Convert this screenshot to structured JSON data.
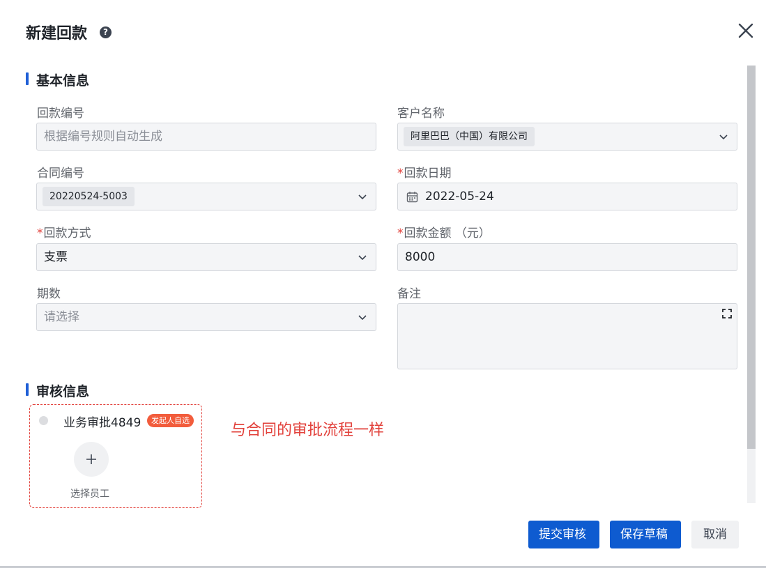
{
  "dialog": {
    "title": "新建回款",
    "help_icon": "question-circle-icon",
    "close_icon": "close-icon"
  },
  "sections": {
    "basic_info": "基本信息",
    "approval_info": "审核信息"
  },
  "fields": {
    "payment_no": {
      "label": "回款编号",
      "placeholder": "根据编号规则自动生成"
    },
    "customer_name": {
      "label": "客户名称",
      "value": "阿里巴巴（中国）有限公司"
    },
    "contract_no": {
      "label": "合同编号",
      "value": "20220524-5003"
    },
    "payment_date": {
      "label": "回款日期",
      "required": "*",
      "value": "2022-05-24"
    },
    "payment_method": {
      "label": "回款方式",
      "required": "*",
      "value": "支票"
    },
    "payment_amount": {
      "label": "回款金额 （元）",
      "required": "*",
      "value": "8000"
    },
    "period": {
      "label": "期数",
      "placeholder": "请选择"
    },
    "remark": {
      "label": "备注",
      "value": ""
    }
  },
  "approval": {
    "node_name": "业务审批4849",
    "node_tag": "发起人自选",
    "add_label": "选择员工",
    "annotation": "与合同的审批流程一样"
  },
  "buttons": {
    "submit": "提交审核",
    "save_draft": "保存草稿",
    "cancel": "取消"
  },
  "colors": {
    "primary": "#0e5bd0",
    "required": "#e2413b",
    "section_accent": "#1f5fd6",
    "tag": "#f25c3c"
  }
}
